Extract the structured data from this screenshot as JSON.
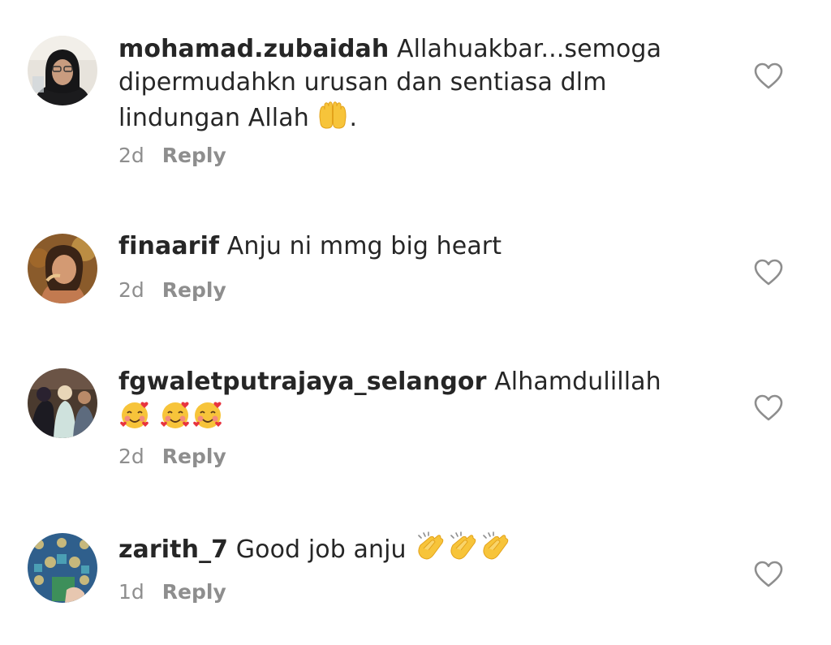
{
  "comments": [
    {
      "username": "mohamad.zubaidah",
      "text_parts": [
        "Allahuakbar...semoga dipermudahkn urusan dan sentiasa dlm lindungan Allah ",
        "."
      ],
      "emojis": [
        "raising-hands"
      ],
      "time": "2d",
      "reply_label": "Reply"
    },
    {
      "username": "finaarif",
      "text_parts": [
        "Anju ni mmg big heart"
      ],
      "time": "2d",
      "reply_label": "Reply"
    },
    {
      "username": "fgwaletputrajaya_selangor",
      "text_parts": [
        "Alhamdulillah"
      ],
      "emojis": [
        "smiling-face-with-hearts",
        "smiling-face-with-hearts",
        "smiling-face-with-hearts"
      ],
      "time": "2d",
      "reply_label": "Reply"
    },
    {
      "username": "zarith_7",
      "text_parts": [
        "Good job anju "
      ],
      "emojis": [
        "clapping-hands",
        "clapping-hands",
        "clapping-hands"
      ],
      "time": "1d",
      "reply_label": "Reply"
    }
  ],
  "icons": {
    "like": "heart-outline-icon"
  },
  "colors": {
    "text": "#262626",
    "meta": "#8e8e8e",
    "heart_stroke": "#8e8e8e",
    "background": "#ffffff"
  }
}
